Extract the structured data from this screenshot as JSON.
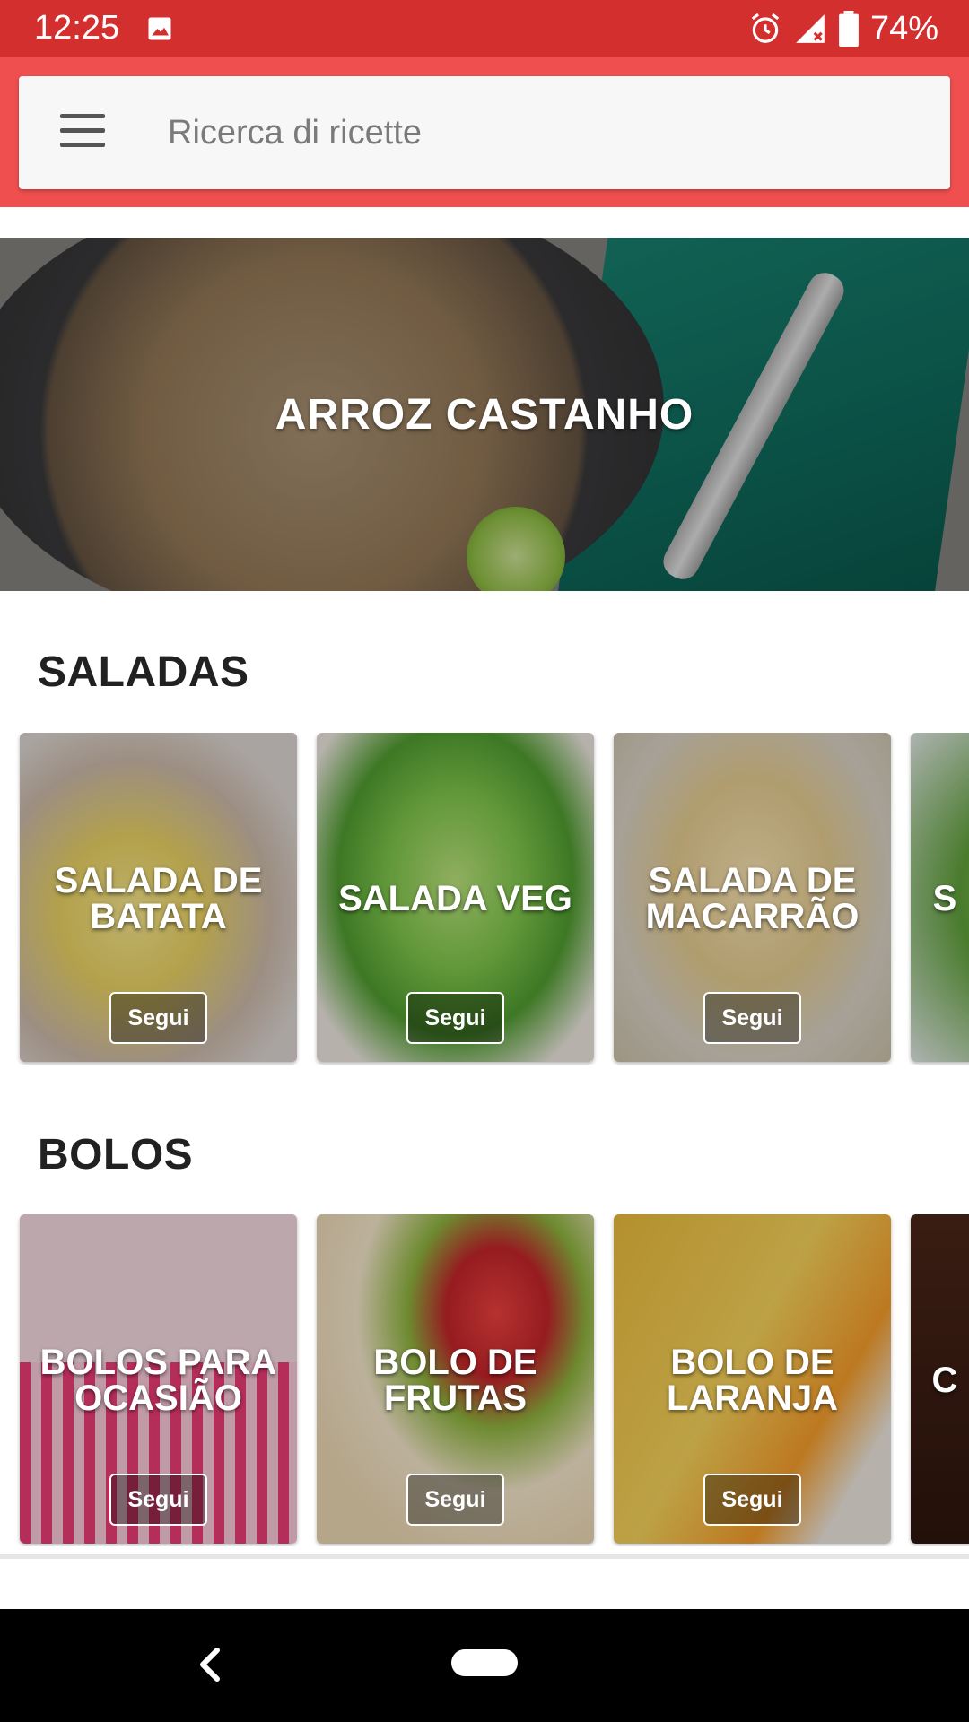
{
  "status_bar": {
    "time": "12:25",
    "battery": "74%",
    "icons": [
      "image-icon",
      "alarm-icon",
      "signal-icon",
      "battery-icon"
    ]
  },
  "search": {
    "placeholder": "Ricerca di ricette",
    "menu_icon": "hamburger-menu-icon"
  },
  "hero": {
    "title": "ARROZ CASTANHO"
  },
  "sections": [
    {
      "title": "SALADAS",
      "cards": [
        {
          "title": "SALADA DE BATATA",
          "button": "Segui"
        },
        {
          "title": "SALADA VEG",
          "button": "Segui"
        },
        {
          "title": "SALADA DE MACARRÃO",
          "button": "Segui"
        },
        {
          "title": "S",
          "button": ""
        }
      ]
    },
    {
      "title": "BOLOS",
      "cards": [
        {
          "title": "BOLOS PARA OCASIÃO",
          "button": "Segui"
        },
        {
          "title": "BOLO DE FRUTAS",
          "button": "Segui"
        },
        {
          "title": "BOLO DE LARANJA",
          "button": "Segui"
        },
        {
          "title": "C",
          "button": ""
        }
      ]
    }
  ],
  "colors": {
    "status_bar": "#d32f2f",
    "app_bar": "#ef4f4f",
    "section_title": "#212121"
  }
}
